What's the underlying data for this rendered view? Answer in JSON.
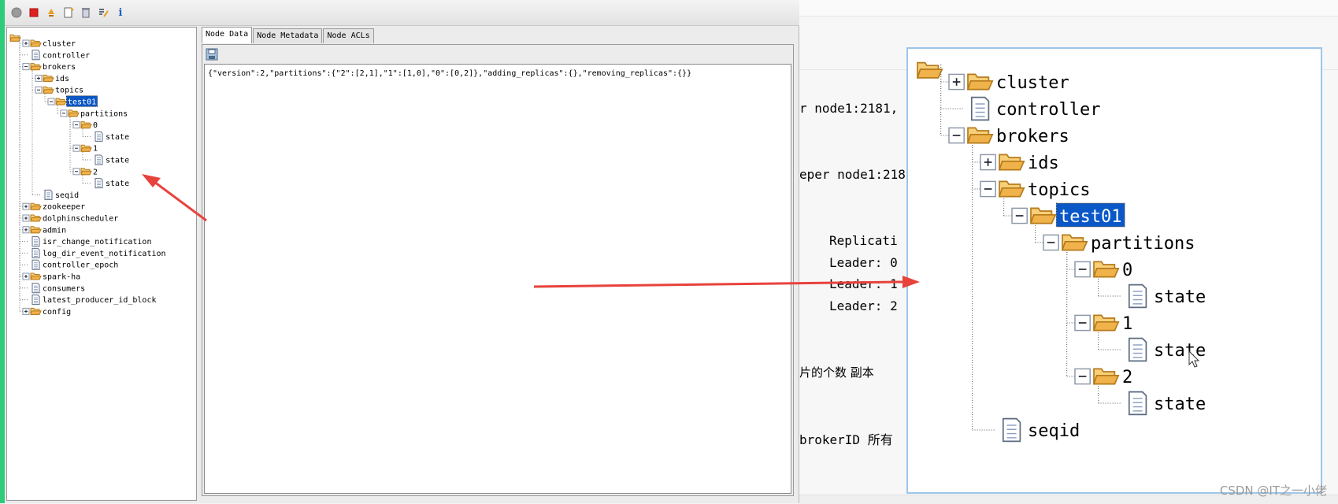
{
  "toolbar": {
    "buttons": [
      {
        "name": "connect-icon"
      },
      {
        "name": "disconnect-icon"
      },
      {
        "name": "refresh-icon"
      },
      {
        "name": "add-node-icon"
      },
      {
        "name": "delete-node-icon"
      },
      {
        "name": "edit-icon"
      },
      {
        "name": "info-icon",
        "glyph": "i"
      }
    ]
  },
  "tree": {
    "nodes": [
      {
        "label": "cluster",
        "depth": 1,
        "type": "folder",
        "toggle": "plus"
      },
      {
        "label": "controller",
        "depth": 1,
        "type": "file",
        "toggle": "none"
      },
      {
        "label": "brokers",
        "depth": 1,
        "type": "folder",
        "toggle": "minus"
      },
      {
        "label": "ids",
        "depth": 2,
        "type": "folder",
        "toggle": "plus"
      },
      {
        "label": "topics",
        "depth": 2,
        "type": "folder",
        "toggle": "minus"
      },
      {
        "label": "test01",
        "depth": 3,
        "type": "folder",
        "toggle": "minus",
        "selected": true
      },
      {
        "label": "partitions",
        "depth": 4,
        "type": "folder",
        "toggle": "minus"
      },
      {
        "label": "0",
        "depth": 5,
        "type": "folder",
        "toggle": "minus"
      },
      {
        "label": "state",
        "depth": 6,
        "type": "file",
        "toggle": "none"
      },
      {
        "label": "1",
        "depth": 5,
        "type": "folder",
        "toggle": "minus"
      },
      {
        "label": "state",
        "depth": 6,
        "type": "file",
        "toggle": "none"
      },
      {
        "label": "2",
        "depth": 5,
        "type": "folder",
        "toggle": "minus"
      },
      {
        "label": "state",
        "depth": 6,
        "type": "file",
        "toggle": "none"
      },
      {
        "label": "seqid",
        "depth": 2,
        "type": "file",
        "toggle": "none"
      },
      {
        "label": "zookeeper",
        "depth": 1,
        "type": "folder",
        "toggle": "plus"
      },
      {
        "label": "dolphinscheduler",
        "depth": 1,
        "type": "folder",
        "toggle": "plus"
      },
      {
        "label": "admin",
        "depth": 1,
        "type": "folder",
        "toggle": "plus"
      },
      {
        "label": "isr_change_notification",
        "depth": 1,
        "type": "file",
        "toggle": "none"
      },
      {
        "label": "log_dir_event_notification",
        "depth": 1,
        "type": "file",
        "toggle": "none"
      },
      {
        "label": "controller_epoch",
        "depth": 1,
        "type": "file",
        "toggle": "none"
      },
      {
        "label": "spark-ha",
        "depth": 1,
        "type": "folder",
        "toggle": "plus"
      },
      {
        "label": "consumers",
        "depth": 1,
        "type": "file",
        "toggle": "none"
      },
      {
        "label": "latest_producer_id_block",
        "depth": 1,
        "type": "file",
        "toggle": "none"
      },
      {
        "label": "config",
        "depth": 1,
        "type": "folder",
        "toggle": "plus"
      }
    ]
  },
  "tabs": [
    {
      "label": "Node Data",
      "active": true
    },
    {
      "label": "Node Metadata",
      "active": false
    },
    {
      "label": "Node ACLs",
      "active": false
    }
  ],
  "node_data": "{\"version\":2,\"partitions\":{\"2\":[2,1],\"1\":[1,0],\"0\":[0,2]},\"adding_replicas\":{},\"removing_replicas\":{}}",
  "ide": {
    "lines": [
      {
        "text": "r node1:2181,",
        "color": "#1a3fb0"
      },
      {
        "text": "eper node1:218",
        "color": "#1a3fb0"
      },
      {
        "text": "Replicati",
        "color": "#2a9a2a"
      },
      {
        "text": "Leader: 0",
        "color": "#2a9a2a"
      },
      {
        "text": "Leader: 1",
        "color": "#2a9a2a"
      },
      {
        "text": "Leader: 2",
        "color": "#2a9a2a"
      },
      {
        "text": "片的个数  副本",
        "color": "#2a9a2a"
      },
      {
        "text": "brokerID  所有",
        "color": "#1a3fb0"
      }
    ]
  },
  "zoom": {
    "nodes": [
      {
        "label": "cluster",
        "depth": 1,
        "type": "folder",
        "toggle": "plus"
      },
      {
        "label": "controller",
        "depth": 1,
        "type": "file",
        "toggle": "none"
      },
      {
        "label": "brokers",
        "depth": 1,
        "type": "folder",
        "toggle": "minus"
      },
      {
        "label": "ids",
        "depth": 2,
        "type": "folder",
        "toggle": "plus"
      },
      {
        "label": "topics",
        "depth": 2,
        "type": "folder",
        "toggle": "minus"
      },
      {
        "label": "test01",
        "depth": 3,
        "type": "folder",
        "toggle": "minus",
        "selected": true
      },
      {
        "label": "partitions",
        "depth": 4,
        "type": "folder",
        "toggle": "minus"
      },
      {
        "label": "0",
        "depth": 5,
        "type": "folder",
        "toggle": "minus"
      },
      {
        "label": "state",
        "depth": 6,
        "type": "file",
        "toggle": "none"
      },
      {
        "label": "1",
        "depth": 5,
        "type": "folder",
        "toggle": "minus"
      },
      {
        "label": "state",
        "depth": 6,
        "type": "file",
        "toggle": "none"
      },
      {
        "label": "2",
        "depth": 5,
        "type": "folder",
        "toggle": "minus"
      },
      {
        "label": "state",
        "depth": 6,
        "type": "file",
        "toggle": "none"
      },
      {
        "label": "seqid",
        "depth": 2,
        "type": "file",
        "toggle": "none"
      }
    ]
  },
  "watermark": "CSDN @IT之一小佬",
  "colors": {
    "accent_green": "#2ccc7a",
    "selection": "#0a58c8",
    "folder": "#f0b24a",
    "arrow": "#e8423c"
  }
}
